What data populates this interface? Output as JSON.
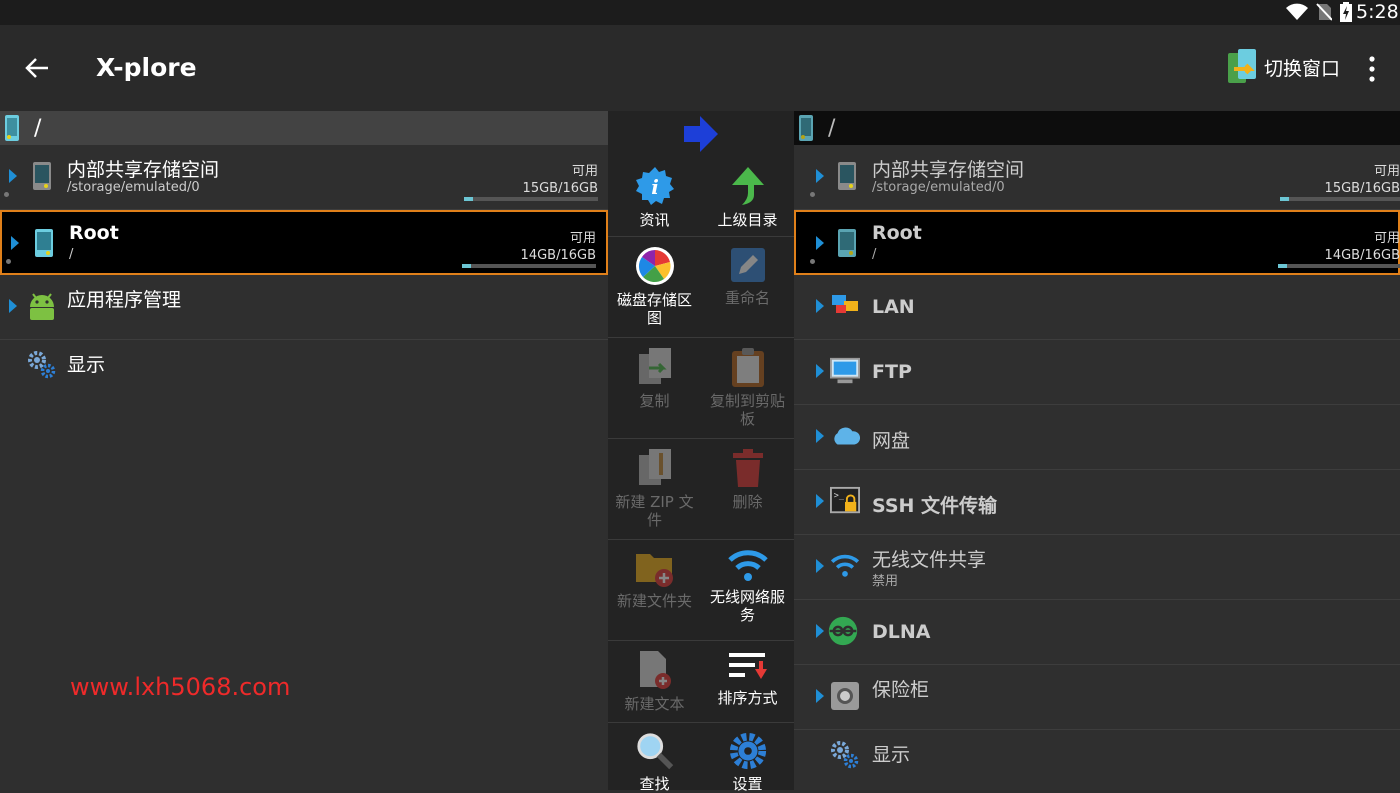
{
  "status": {
    "time": "5:28"
  },
  "appbar": {
    "title": "X-plore",
    "switch_label": "切换窗口"
  },
  "left": {
    "path": "/",
    "items": [
      {
        "name": "内部共享存储空间",
        "sub": "/storage/emulated/0",
        "avail": "可用",
        "size": "15GB/16GB",
        "fill": 0.07
      },
      {
        "name": "Root",
        "sub": "/",
        "avail": "可用",
        "size": "14GB/16GB",
        "fill": 0.07
      },
      {
        "name": "应用程序管理"
      },
      {
        "name": "显示"
      }
    ],
    "watermark": "www.lxh5068.com"
  },
  "tools": [
    {
      "label": "资讯",
      "enabled": true,
      "icon": "info-icon"
    },
    {
      "label": "上级目录",
      "enabled": true,
      "icon": "parent-dir-icon"
    },
    {
      "label": "磁盘存储区图",
      "enabled": true,
      "icon": "disk-map-icon"
    },
    {
      "label": "重命名",
      "enabled": false,
      "icon": "rename-icon"
    },
    {
      "label": "复制",
      "enabled": false,
      "icon": "copy-icon"
    },
    {
      "label": "复制到剪贴板",
      "enabled": false,
      "icon": "clipboard-icon"
    },
    {
      "label": "新建 ZIP 文件",
      "enabled": false,
      "icon": "zip-icon"
    },
    {
      "label": "删除",
      "enabled": false,
      "icon": "trash-icon"
    },
    {
      "label": "新建文件夹",
      "enabled": false,
      "icon": "new-folder-icon"
    },
    {
      "label": "无线网络服务",
      "enabled": true,
      "icon": "wifi-icon"
    },
    {
      "label": "新建文本",
      "enabled": false,
      "icon": "new-text-icon"
    },
    {
      "label": "排序方式",
      "enabled": true,
      "icon": "sort-icon"
    },
    {
      "label": "查找",
      "enabled": true,
      "icon": "search-icon"
    },
    {
      "label": "设置",
      "enabled": true,
      "icon": "settings-icon"
    }
  ],
  "right": {
    "path": "/",
    "items": [
      {
        "name": "内部共享存储空间",
        "sub": "/storage/emulated/0",
        "avail": "可用",
        "size": "15GB/16GB",
        "fill": 0.07
      },
      {
        "name": "Root",
        "sub": "/",
        "avail": "可用",
        "size": "14GB/16GB",
        "fill": 0.07
      },
      {
        "name": "LAN"
      },
      {
        "name": "FTP"
      },
      {
        "name": "网盘"
      },
      {
        "name": "SSH 文件传输"
      },
      {
        "name": "无线文件共享",
        "sub": "禁用"
      },
      {
        "name": "DLNA"
      },
      {
        "name": "保险柜"
      },
      {
        "name": "显示"
      }
    ]
  },
  "colors": {
    "accent": "#1f8fd6",
    "selection_border": "#e0801a",
    "watermark": "#ee2a2a"
  }
}
